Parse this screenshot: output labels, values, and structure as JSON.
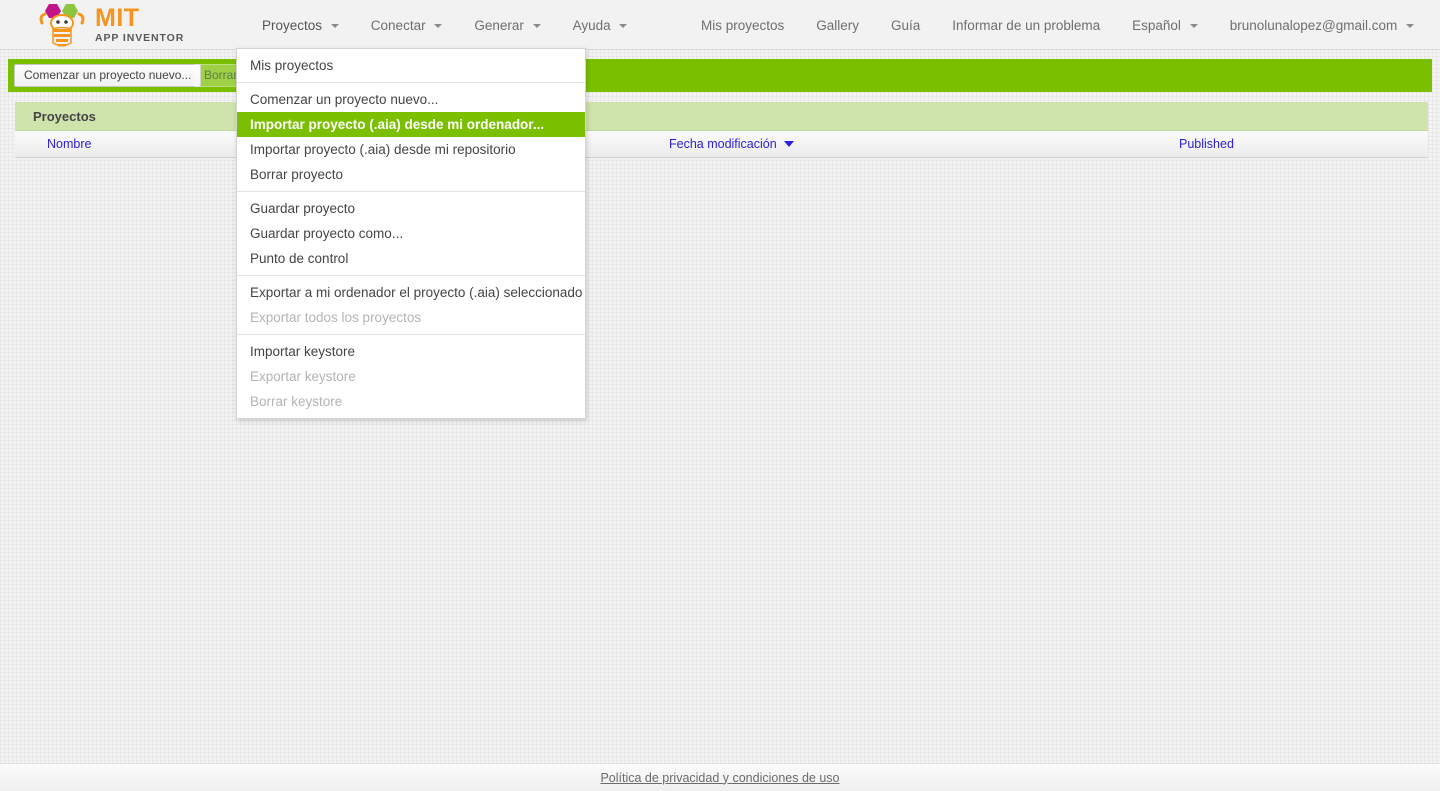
{
  "header": {
    "logo": {
      "icon": "app-inventor-bee-logo",
      "title": "MIT",
      "subtitle": "APP INVENTOR",
      "colors": {
        "mit_orange": "#f7941e",
        "subtitle_gray": "#58595b",
        "hex_magenta": "#c4138a",
        "hex_green": "#8cc63e"
      }
    },
    "nav_left": [
      {
        "label": "Proyectos",
        "has_caret": true,
        "open": true
      },
      {
        "label": "Conectar",
        "has_caret": true,
        "open": false
      },
      {
        "label": "Generar",
        "has_caret": true,
        "open": false
      },
      {
        "label": "Ayuda",
        "has_caret": true,
        "open": false
      }
    ],
    "nav_right": [
      {
        "label": "Mis proyectos",
        "has_caret": false
      },
      {
        "label": "Gallery",
        "has_caret": false
      },
      {
        "label": "Guía",
        "has_caret": false
      },
      {
        "label": "Informar de un problema",
        "has_caret": false
      },
      {
        "label": "Español",
        "has_caret": true
      },
      {
        "label": "brunolunalopez@gmail.com",
        "has_caret": true
      }
    ]
  },
  "toolbar": {
    "background_color": "#7ac000",
    "buttons": [
      {
        "label": "Comenzar un proyecto nuevo...",
        "enabled": true
      },
      {
        "label": "Borrar proyecto",
        "enabled": false
      }
    ]
  },
  "panel": {
    "title": "Proyectos",
    "columns": [
      {
        "label": "Nombre",
        "sorted": false
      },
      {
        "label": "Fecha modificación",
        "sorted": true,
        "sort_direction": "desc"
      },
      {
        "label": "Published",
        "sorted": false
      }
    ],
    "rows": []
  },
  "menu": {
    "name": "proyectos-dropdown",
    "highlight_color": "#7ac000",
    "groups": [
      {
        "items": [
          {
            "label": "Mis proyectos",
            "enabled": true,
            "highlighted": false
          }
        ]
      },
      {
        "items": [
          {
            "label": "Comenzar un proyecto nuevo...",
            "enabled": true,
            "highlighted": false
          },
          {
            "label": "Importar proyecto (.aia) desde mi ordenador...",
            "enabled": true,
            "highlighted": true
          },
          {
            "label": "Importar proyecto (.aia) desde mi repositorio",
            "enabled": true,
            "highlighted": false
          },
          {
            "label": "Borrar proyecto",
            "enabled": true,
            "highlighted": false
          }
        ]
      },
      {
        "items": [
          {
            "label": "Guardar proyecto",
            "enabled": true,
            "highlighted": false
          },
          {
            "label": "Guardar proyecto como...",
            "enabled": true,
            "highlighted": false
          },
          {
            "label": "Punto de control",
            "enabled": true,
            "highlighted": false
          }
        ]
      },
      {
        "items": [
          {
            "label": "Exportar a mi ordenador el proyecto (.aia) seleccionado",
            "enabled": true,
            "highlighted": false
          },
          {
            "label": "Exportar todos los proyectos",
            "enabled": false,
            "highlighted": false
          }
        ]
      },
      {
        "items": [
          {
            "label": "Importar keystore",
            "enabled": true,
            "highlighted": false
          },
          {
            "label": "Exportar keystore",
            "enabled": false,
            "highlighted": false
          },
          {
            "label": "Borrar keystore",
            "enabled": false,
            "highlighted": false
          }
        ]
      }
    ]
  },
  "footer": {
    "link_label": "Política de privacidad y condiciones de uso"
  }
}
